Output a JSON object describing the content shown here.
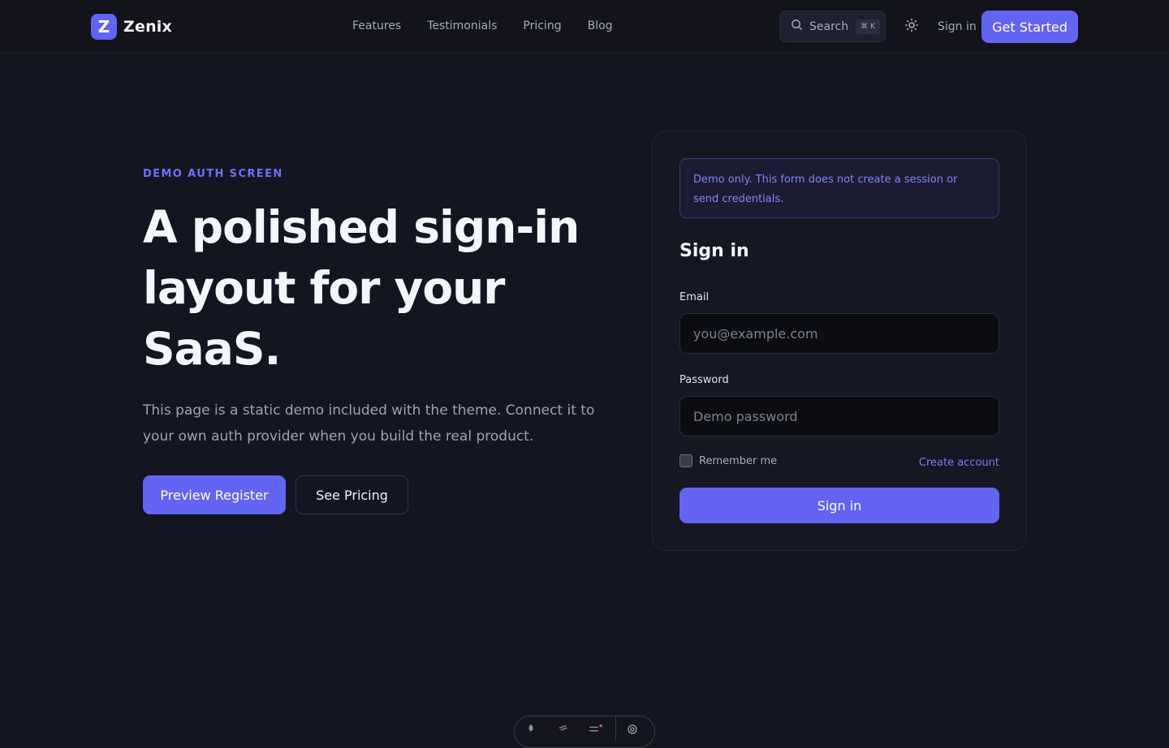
{
  "brand": {
    "logo_letter": "Z",
    "name": "Zenix",
    "accent": "#6364f1"
  },
  "nav": {
    "items": [
      {
        "label": "Features"
      },
      {
        "label": "Testimonials"
      },
      {
        "label": "Pricing"
      },
      {
        "label": "Blog"
      }
    ]
  },
  "search": {
    "label": "Search",
    "shortcut": "⌘ K",
    "icon": "search-icon"
  },
  "header": {
    "theme_icon": "sun-icon",
    "signin_label": "Sign in",
    "cta_label": "Get Started"
  },
  "hero": {
    "eyebrow": "DEMO AUTH SCREEN",
    "title": "A polished sign-in layout for your SaaS.",
    "subtitle": "This page is a static demo included with the theme. Connect it to your own auth provider when you build the real product.",
    "primary_button": "Preview Register",
    "secondary_button": "See Pricing"
  },
  "card": {
    "notice": "Demo only. This form does not create a session or send credentials.",
    "title": "Sign in",
    "email": {
      "label": "Email",
      "placeholder": "you@example.com",
      "value": ""
    },
    "password": {
      "label": "Password",
      "placeholder": "Demo password",
      "value": ""
    },
    "remember_label": "Remember me",
    "remember_checked": false,
    "create_account_label": "Create account",
    "submit_label": "Sign in"
  },
  "dev_toolbar": {
    "icons": [
      "rocket-icon",
      "wand-icon",
      "menu-icon",
      "settings-icon"
    ]
  }
}
